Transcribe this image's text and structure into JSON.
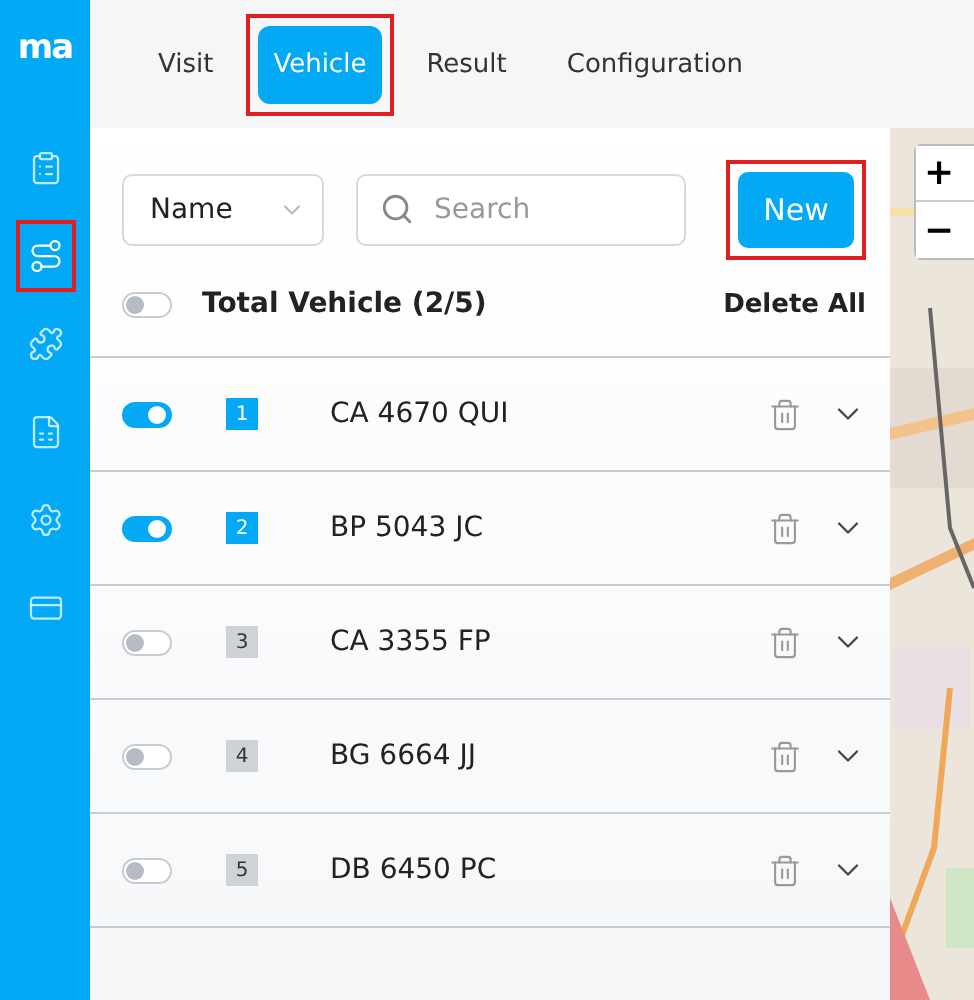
{
  "sidebar": {
    "logo": "ma",
    "items": [
      {
        "kind": "clipboard",
        "selected": false,
        "highlighted": false
      },
      {
        "kind": "route",
        "selected": true,
        "highlighted": true
      },
      {
        "kind": "puzzle",
        "selected": false,
        "highlighted": false
      },
      {
        "kind": "document",
        "selected": false,
        "highlighted": false
      },
      {
        "kind": "settings",
        "selected": false,
        "highlighted": false
      },
      {
        "kind": "card",
        "selected": false,
        "highlighted": false
      }
    ]
  },
  "tabs": [
    {
      "label": "Visit",
      "selected": false,
      "highlighted": false
    },
    {
      "label": "Vehicle",
      "selected": true,
      "highlighted": true
    },
    {
      "label": "Result",
      "selected": false,
      "highlighted": false
    },
    {
      "label": "Configuration",
      "selected": false,
      "highlighted": false
    }
  ],
  "toolbar": {
    "sort": "Name",
    "search": {
      "placeholder": "Search"
    },
    "new_button": {
      "label": "New",
      "highlighted": true
    }
  },
  "summary": {
    "on": false,
    "label": "Total Vehicle (2/5)",
    "delete_all": "Delete All"
  },
  "vehicles": [
    {
      "on": true,
      "index": "1",
      "plate": "CA 4670 QUI"
    },
    {
      "on": true,
      "index": "2",
      "plate": "BP 5043 JC"
    },
    {
      "on": false,
      "index": "3",
      "plate": "CA 3355 FP"
    },
    {
      "on": false,
      "index": "4",
      "plate": "BG 6664 JJ"
    },
    {
      "on": false,
      "index": "5",
      "plate": "DB 6450 PC"
    }
  ],
  "map": {
    "kind": "picture",
    "zoom_in": "+",
    "zoom_out": "−"
  }
}
